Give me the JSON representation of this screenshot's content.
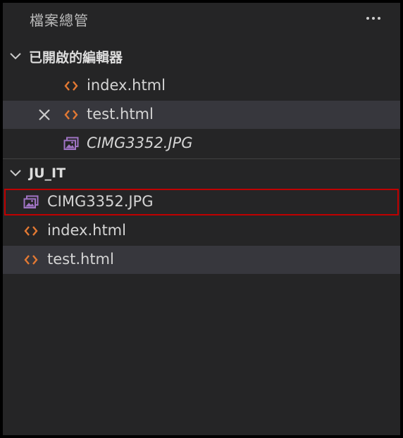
{
  "panel": {
    "title": "檔案總管",
    "more_icon": "ellipsis-icon"
  },
  "open_editors": {
    "title": "已開啟的編輯器",
    "items": [
      {
        "label": "index.html",
        "icon": "html-code-icon",
        "italic": false,
        "selected": false,
        "close": false
      },
      {
        "label": "test.html",
        "icon": "html-code-icon",
        "italic": false,
        "selected": true,
        "close": true
      },
      {
        "label": "CIMG3352.JPG",
        "icon": "image-icon",
        "italic": true,
        "selected": false,
        "close": false
      }
    ]
  },
  "workspace": {
    "title": "JU_IT",
    "items": [
      {
        "label": "CIMG3352.JPG",
        "icon": "image-icon",
        "highlighted": true
      },
      {
        "label": "index.html",
        "icon": "html-code-icon",
        "highlighted": false
      },
      {
        "label": "test.html",
        "icon": "html-code-icon",
        "selected": true
      }
    ]
  },
  "colors": {
    "background": "#252526",
    "selected_row": "#37373d",
    "html_icon": "#e37933",
    "image_icon": "#a074c4",
    "highlight_border": "#c00000"
  }
}
